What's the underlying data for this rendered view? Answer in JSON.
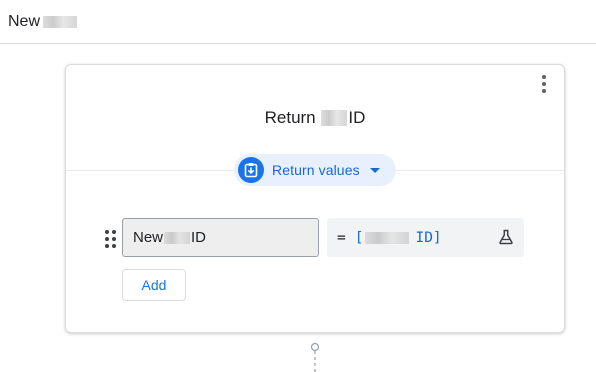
{
  "header": {
    "title": "New"
  },
  "card": {
    "title_prefix": "Return",
    "title_suffix": "ID",
    "chip": {
      "label": "Return values",
      "icon": "return-values-icon"
    },
    "row": {
      "name_prefix": "New",
      "name_suffix": "ID",
      "value_eq": "=",
      "value_open": "[",
      "value_id": "ID]",
      "test_icon": "flask-icon"
    },
    "add_label": "Add"
  },
  "colors": {
    "accent": "#1a73e8",
    "chip_bg": "#e8f0fe",
    "field_bg": "#eeeeee",
    "value_bg": "#f1f3f4",
    "border": "#dadce0"
  }
}
